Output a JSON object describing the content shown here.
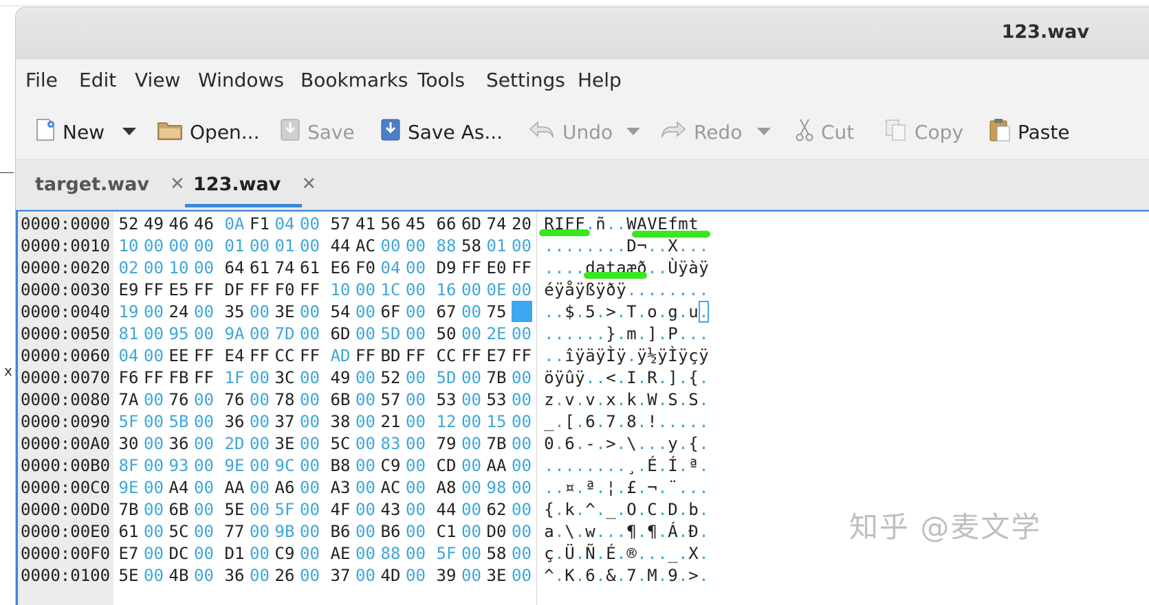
{
  "window": {
    "title": "123.wav"
  },
  "menu": [
    "File",
    "Edit",
    "View",
    "Windows",
    "Bookmarks",
    "Tools",
    "Settings",
    "Help"
  ],
  "toolbar": {
    "new": "New",
    "open": "Open...",
    "save": "Save",
    "save_as": "Save As...",
    "undo": "Undo",
    "redo": "Redo",
    "cut": "Cut",
    "copy": "Copy",
    "paste": "Paste"
  },
  "tabs": [
    {
      "label": "target.wav",
      "close": "✕"
    },
    {
      "label": "123.wav",
      "close": "✕"
    }
  ],
  "hex_rows": [
    {
      "addr": "0000:0000",
      "bytes": [
        "52",
        "49",
        "46",
        "46",
        "0A",
        "F1",
        "04",
        "00",
        "57",
        "41",
        "56",
        "45",
        "66",
        "6D",
        "74",
        "20"
      ],
      "ascii": "RIFF.ñ..WAVEfmt "
    },
    {
      "addr": "0000:0010",
      "bytes": [
        "10",
        "00",
        "00",
        "00",
        "01",
        "00",
        "01",
        "00",
        "44",
        "AC",
        "00",
        "00",
        "88",
        "58",
        "01",
        "00"
      ],
      "ascii": "........D¬..X..."
    },
    {
      "addr": "0000:0020",
      "bytes": [
        "02",
        "00",
        "10",
        "00",
        "64",
        "61",
        "74",
        "61",
        "E6",
        "F0",
        "04",
        "00",
        "D9",
        "FF",
        "E0",
        "FF"
      ],
      "ascii": "....dataæð..Ùÿàÿ"
    },
    {
      "addr": "0000:0030",
      "bytes": [
        "E9",
        "FF",
        "E5",
        "FF",
        "DF",
        "FF",
        "F0",
        "FF",
        "10",
        "00",
        "1C",
        "00",
        "16",
        "00",
        "0E",
        "00"
      ],
      "ascii": "éÿåÿßÿðÿ........"
    },
    {
      "addr": "0000:0040",
      "bytes": [
        "19",
        "00",
        "24",
        "00",
        "35",
        "00",
        "3E",
        "00",
        "54",
        "00",
        "6F",
        "00",
        "67",
        "00",
        "75",
        ""
      ],
      "ascii": "..$.5.>.T.o.g.u."
    },
    {
      "addr": "0000:0050",
      "bytes": [
        "81",
        "00",
        "95",
        "00",
        "9A",
        "00",
        "7D",
        "00",
        "6D",
        "00",
        "5D",
        "00",
        "50",
        "00",
        "2E",
        "00"
      ],
      "ascii": "......}.m.].P..."
    },
    {
      "addr": "0000:0060",
      "bytes": [
        "04",
        "00",
        "EE",
        "FF",
        "E4",
        "FF",
        "CC",
        "FF",
        "AD",
        "FF",
        "BD",
        "FF",
        "CC",
        "FF",
        "E7",
        "FF"
      ],
      "ascii": "..îÿäÿÌÿ.ÿ½ÿÌÿçÿ"
    },
    {
      "addr": "0000:0070",
      "bytes": [
        "F6",
        "FF",
        "FB",
        "FF",
        "1F",
        "00",
        "3C",
        "00",
        "49",
        "00",
        "52",
        "00",
        "5D",
        "00",
        "7B",
        "00"
      ],
      "ascii": "öÿûÿ..<.I.R.].{."
    },
    {
      "addr": "0000:0080",
      "bytes": [
        "7A",
        "00",
        "76",
        "00",
        "76",
        "00",
        "78",
        "00",
        "6B",
        "00",
        "57",
        "00",
        "53",
        "00",
        "53",
        "00"
      ],
      "ascii": "z.v.v.x.k.W.S.S."
    },
    {
      "addr": "0000:0090",
      "bytes": [
        "5F",
        "00",
        "5B",
        "00",
        "36",
        "00",
        "37",
        "00",
        "38",
        "00",
        "21",
        "00",
        "12",
        "00",
        "15",
        "00"
      ],
      "ascii": "_.[.6.7.8.!....."
    },
    {
      "addr": "0000:00A0",
      "bytes": [
        "30",
        "00",
        "36",
        "00",
        "2D",
        "00",
        "3E",
        "00",
        "5C",
        "00",
        "83",
        "00",
        "79",
        "00",
        "7B",
        "00"
      ],
      "ascii": "0.6.-.>.\\...y.{."
    },
    {
      "addr": "0000:00B0",
      "bytes": [
        "8F",
        "00",
        "93",
        "00",
        "9E",
        "00",
        "9C",
        "00",
        "B8",
        "00",
        "C9",
        "00",
        "CD",
        "00",
        "AA",
        "00"
      ],
      "ascii": "........¸.É.Í.ª."
    },
    {
      "addr": "0000:00C0",
      "bytes": [
        "9E",
        "00",
        "A4",
        "00",
        "AA",
        "00",
        "A6",
        "00",
        "A3",
        "00",
        "AC",
        "00",
        "A8",
        "00",
        "98",
        "00"
      ],
      "ascii": "..¤.ª.¦.£.¬.¨..."
    },
    {
      "addr": "0000:00D0",
      "bytes": [
        "7B",
        "00",
        "6B",
        "00",
        "5E",
        "00",
        "5F",
        "00",
        "4F",
        "00",
        "43",
        "00",
        "44",
        "00",
        "62",
        "00"
      ],
      "ascii": "{.k.^._.O.C.D.b."
    },
    {
      "addr": "0000:00E0",
      "bytes": [
        "61",
        "00",
        "5C",
        "00",
        "77",
        "00",
        "9B",
        "00",
        "B6",
        "00",
        "B6",
        "00",
        "C1",
        "00",
        "D0",
        "00"
      ],
      "ascii": "a.\\.w...¶.¶.Á.Ð."
    },
    {
      "addr": "0000:00F0",
      "bytes": [
        "E7",
        "00",
        "DC",
        "00",
        "D1",
        "00",
        "C9",
        "00",
        "AE",
        "00",
        "88",
        "00",
        "5F",
        "00",
        "58",
        "00"
      ],
      "ascii": "ç.Ü.Ñ.É.®..._.X."
    },
    {
      "addr": "0000:0100",
      "bytes": [
        "5E",
        "00",
        "4B",
        "00",
        "36",
        "00",
        "26",
        "00",
        "37",
        "00",
        "4D",
        "00",
        "39",
        "00",
        "3E",
        "00"
      ],
      "ascii": "^.K.6.&.7.M.9.>."
    }
  ],
  "watermark": "知乎 @麦文学",
  "colors": {
    "accent": "#3a86d8",
    "zero_byte": "#3fa6d6",
    "highlight": "#39e620"
  }
}
